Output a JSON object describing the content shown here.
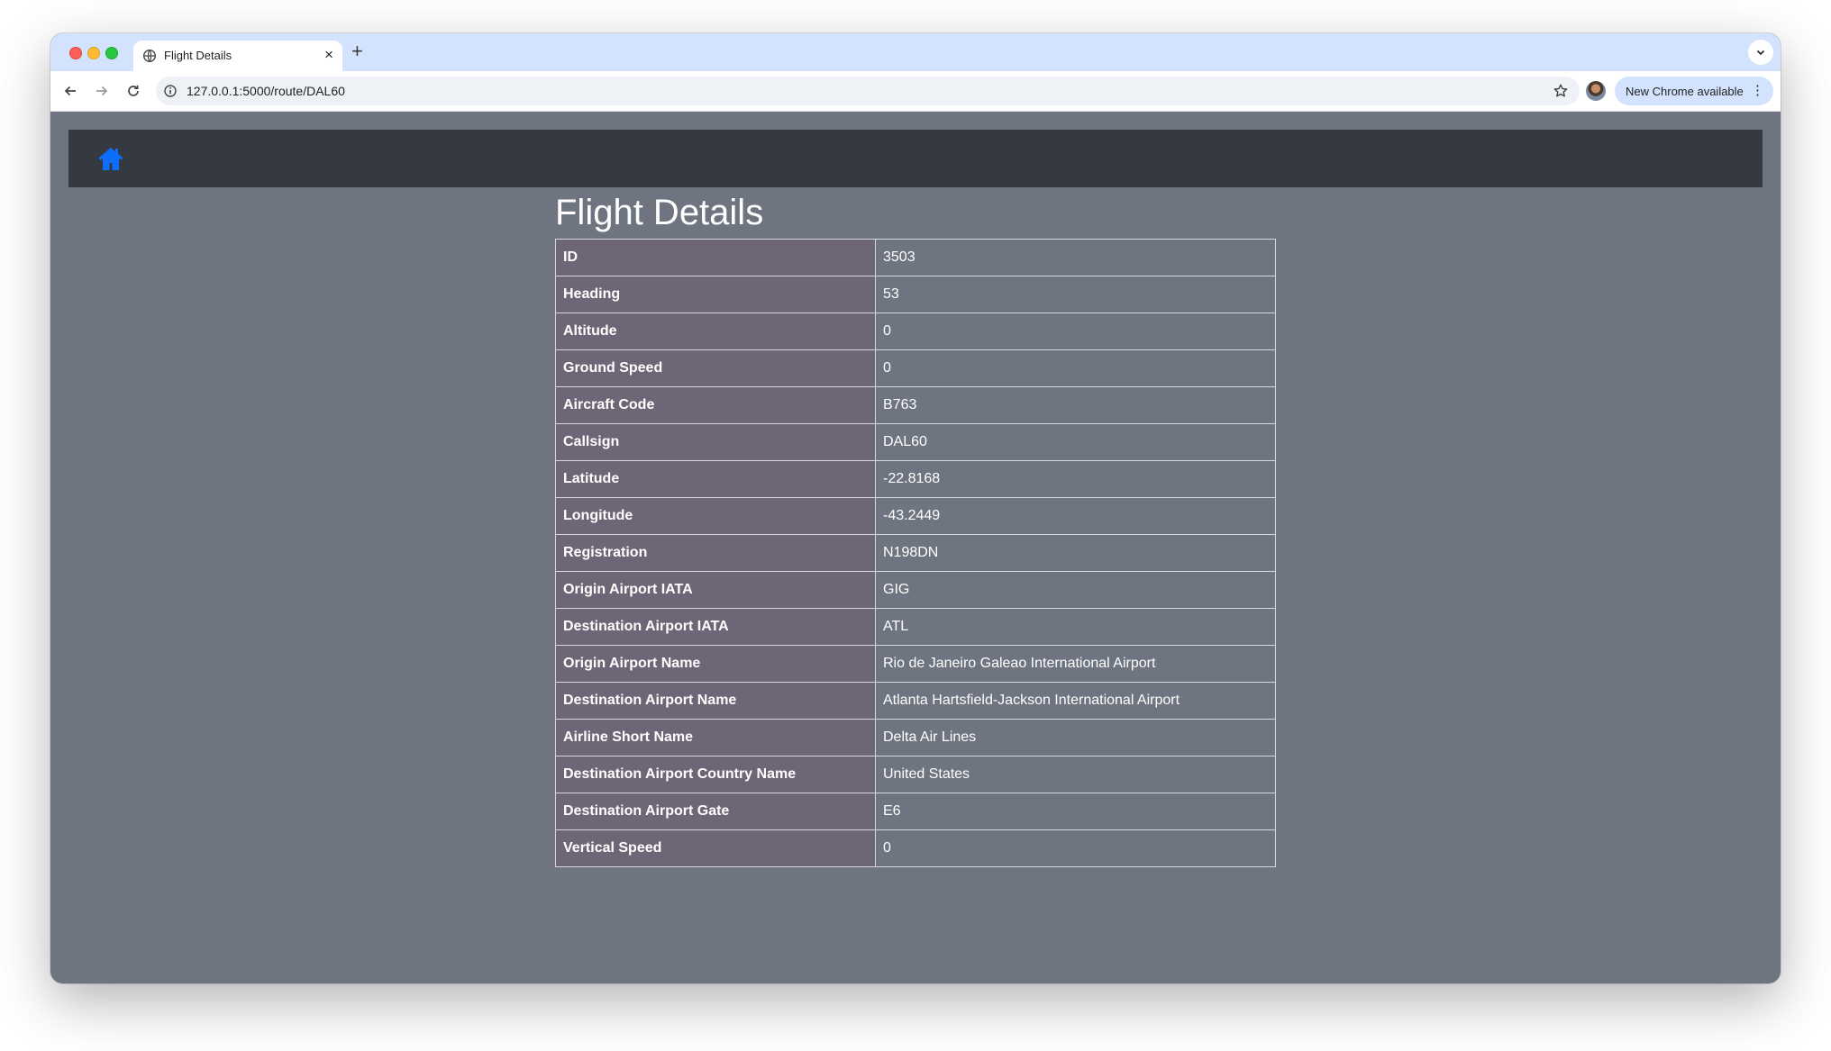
{
  "browser": {
    "tab_title": "Flight Details",
    "url": "127.0.0.1:5000/route/DAL60",
    "update_label": "New Chrome available"
  },
  "page": {
    "title": "Flight Details",
    "home_icon": "home-icon",
    "colors": {
      "background": "#6f7580",
      "navbar": "#343a40",
      "key_cell": "#6e6676",
      "home_icon": "#0d6efd"
    }
  },
  "flight": {
    "rows": [
      {
        "label": "ID",
        "value": "3503"
      },
      {
        "label": "Heading",
        "value": "53"
      },
      {
        "label": "Altitude",
        "value": "0"
      },
      {
        "label": "Ground Speed",
        "value": "0"
      },
      {
        "label": "Aircraft Code",
        "value": "B763"
      },
      {
        "label": "Callsign",
        "value": "DAL60"
      },
      {
        "label": "Latitude",
        "value": "-22.8168"
      },
      {
        "label": "Longitude",
        "value": "-43.2449"
      },
      {
        "label": "Registration",
        "value": "N198DN"
      },
      {
        "label": "Origin Airport IATA",
        "value": "GIG"
      },
      {
        "label": "Destination Airport IATA",
        "value": "ATL"
      },
      {
        "label": "Origin Airport Name",
        "value": "Rio de Janeiro Galeao International Airport"
      },
      {
        "label": "Destination Airport Name",
        "value": "Atlanta Hartsfield-Jackson International Airport"
      },
      {
        "label": "Airline Short Name",
        "value": "Delta Air Lines"
      },
      {
        "label": "Destination Airport Country Name",
        "value": "United States"
      },
      {
        "label": "Destination Airport Gate",
        "value": "E6"
      },
      {
        "label": "Vertical Speed",
        "value": "0"
      }
    ]
  }
}
